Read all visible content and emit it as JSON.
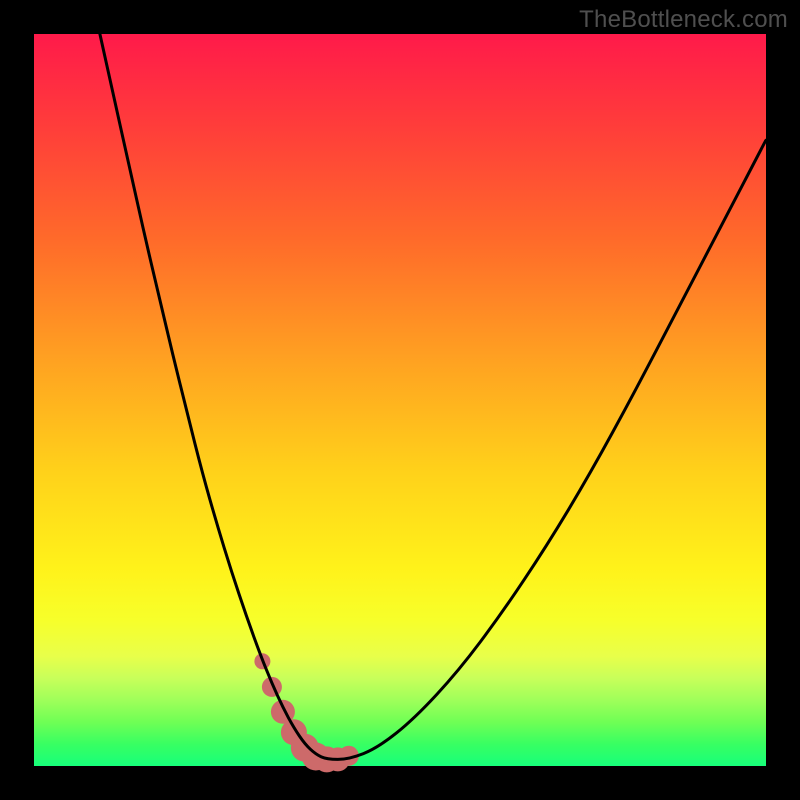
{
  "watermark": "TheBottleneck.com",
  "colors": {
    "frame": "#000000",
    "curve": "#000000",
    "marker": "#cd6a6a",
    "watermark_text": "#4f4f4f"
  },
  "chart_data": {
    "type": "line",
    "title": "",
    "xlabel": "",
    "ylabel": "",
    "xlim": [
      0,
      100
    ],
    "ylim": [
      0,
      100
    ],
    "grid": false,
    "legend": false,
    "series": [
      {
        "name": "bottleneck-curve",
        "x": [
          9,
          11,
          13,
          15,
          17,
          19,
          21,
          23,
          25,
          27,
          29,
          31,
          32.5,
          34,
          35.5,
          37,
          38.5,
          40,
          43,
          47,
          52,
          58,
          64,
          70,
          76,
          82,
          88,
          94,
          100
        ],
        "y": [
          100,
          91,
          82,
          73,
          64.5,
          56,
          48,
          40,
          33,
          26.5,
          20.5,
          15,
          11.3,
          8,
          5.2,
          3,
          1.6,
          0.9,
          0.9,
          2.5,
          6.5,
          13,
          21,
          30,
          40,
          51,
          62.5,
          74,
          85.5
        ]
      }
    ],
    "markers": {
      "name": "highlight-trough",
      "x": [
        31.2,
        32.5,
        34,
        35.5,
        37,
        38.5,
        40,
        41.5,
        43
      ],
      "y": [
        14.3,
        10.8,
        7.4,
        4.6,
        2.5,
        1.3,
        0.9,
        0.9,
        1.4
      ],
      "radii": [
        8,
        10,
        12,
        13,
        14,
        14,
        13,
        12,
        10
      ]
    }
  }
}
